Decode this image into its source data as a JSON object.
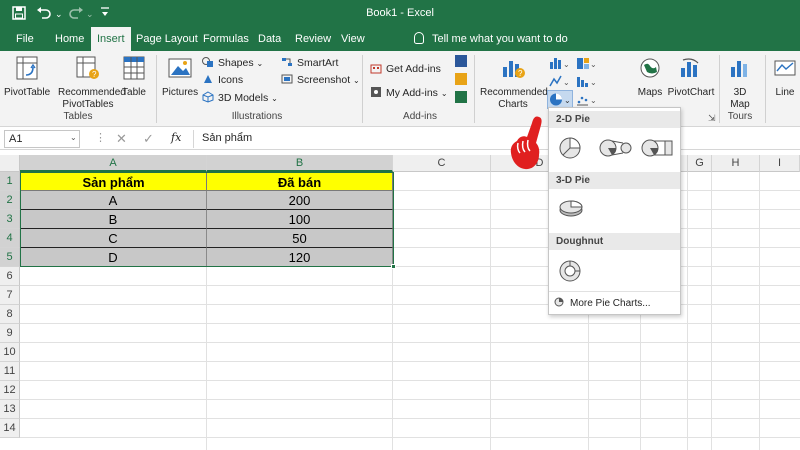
{
  "window": {
    "title": "Book1  -  Excel"
  },
  "tabs": [
    "File",
    "Home",
    "Insert",
    "Page Layout",
    "Formulas",
    "Data",
    "Review",
    "View"
  ],
  "active_tab": "Insert",
  "tell_me": "Tell me what you want to do",
  "ribbon": {
    "tables": {
      "pivottable": "PivotTable",
      "recommended_pivot_1": "Recommended",
      "recommended_pivot_2": "PivotTables",
      "table": "Table",
      "label": "Tables"
    },
    "illustrations": {
      "pictures": "Pictures",
      "shapes": "Shapes",
      "icons": "Icons",
      "models": "3D Models",
      "smartart": "SmartArt",
      "screenshot": "Screenshot",
      "label": "Illustrations"
    },
    "addins": {
      "get": "Get Add-ins",
      "my": "My Add-ins",
      "label": "Add-ins"
    },
    "charts": {
      "recommended_1": "Recommended",
      "recommended_2": "Charts",
      "maps": "Maps",
      "pivotchart": "PivotChart"
    },
    "tours": {
      "map_1": "3D",
      "map_2": "Map",
      "label": "Tours"
    },
    "sparklines": {
      "line": "Line"
    }
  },
  "formula_bar": {
    "name_box": "A1",
    "fx": "fx",
    "content": "Sản phẩm"
  },
  "columns": [
    "A",
    "B",
    "C",
    "D",
    "E",
    "F",
    "G",
    "H",
    "I"
  ],
  "rows": [
    "1",
    "2",
    "3",
    "4",
    "5",
    "6",
    "7",
    "8",
    "9",
    "10",
    "11",
    "12",
    "13",
    "14"
  ],
  "table": {
    "headers": [
      "Sản phẩm",
      "Đã bán"
    ],
    "rows": [
      [
        "A",
        "200"
      ],
      [
        "B",
        "100"
      ],
      [
        "C",
        "50"
      ],
      [
        "D",
        "120"
      ]
    ]
  },
  "pie_dropdown": {
    "section_2d": "2-D Pie",
    "section_3d": "3-D Pie",
    "section_doughnut": "Doughnut",
    "more": "More Pie Charts..."
  },
  "colors": {
    "excel_green": "#217346",
    "header_fill": "#ffff00",
    "data_fill": "#c8c8c8",
    "pointer_red": "#e02020"
  }
}
